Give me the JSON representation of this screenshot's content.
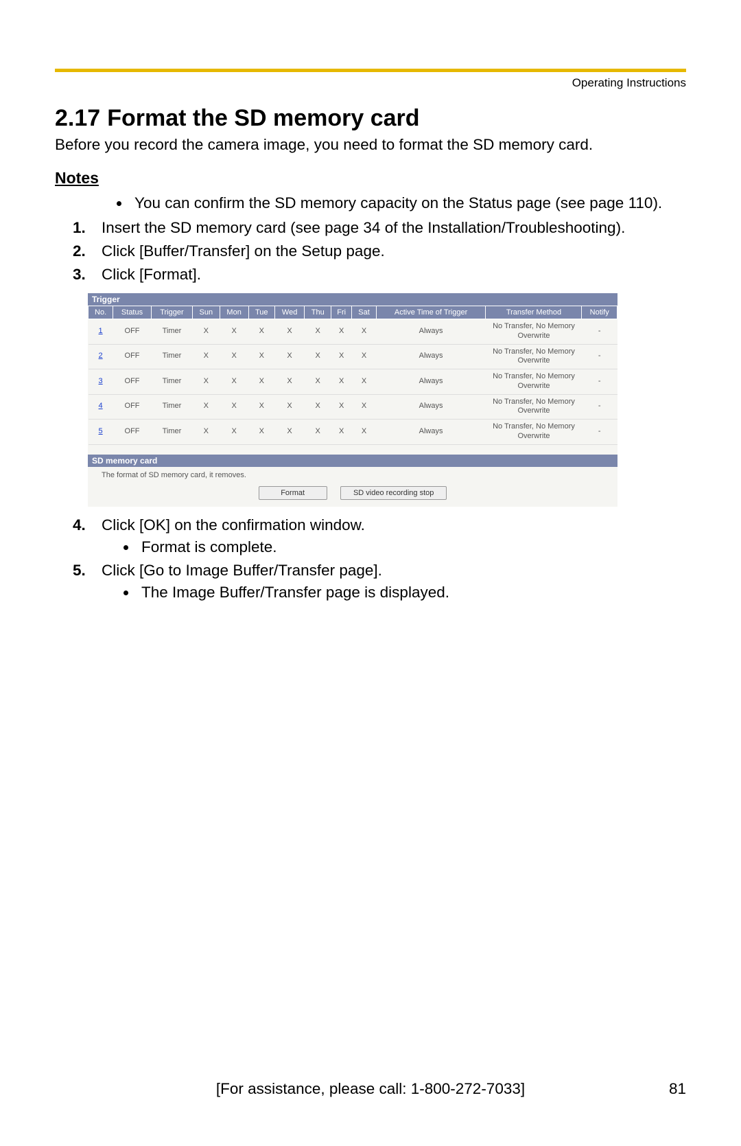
{
  "header": {
    "label": "Operating Instructions"
  },
  "section": {
    "number": "2.17",
    "title": "Format the SD memory card"
  },
  "intro": "Before you record the camera image, you need to format the SD memory card.",
  "notes": {
    "heading": "Notes",
    "items": [
      "You can confirm the SD memory capacity on the Status page (see page 110)."
    ]
  },
  "steps": [
    {
      "text": "Insert the SD memory card (see page 34 of the Installation/Troubleshooting)."
    },
    {
      "text": "Click [Buffer/Transfer] on the Setup page."
    },
    {
      "text": "Click [Format]."
    },
    {
      "text": "Click [OK] on the confirmation window.",
      "sub": [
        "Format is complete."
      ]
    },
    {
      "text": "Click [Go to Image Buffer/Transfer page].",
      "sub": [
        "The Image Buffer/Transfer page is displayed."
      ]
    }
  ],
  "trigger_panel": {
    "title": "Trigger",
    "columns": [
      "No.",
      "Status",
      "Trigger",
      "Sun",
      "Mon",
      "Tue",
      "Wed",
      "Thu",
      "Fri",
      "Sat",
      "Active Time of Trigger",
      "Transfer Method",
      "Notify"
    ],
    "rows": [
      {
        "no": "1",
        "status": "OFF",
        "trigger": "Timer",
        "days": [
          "X",
          "X",
          "X",
          "X",
          "X",
          "X",
          "X"
        ],
        "active": "Always",
        "method": "No Transfer, No Memory Overwrite",
        "notify": "-"
      },
      {
        "no": "2",
        "status": "OFF",
        "trigger": "Timer",
        "days": [
          "X",
          "X",
          "X",
          "X",
          "X",
          "X",
          "X"
        ],
        "active": "Always",
        "method": "No Transfer, No Memory Overwrite",
        "notify": "-"
      },
      {
        "no": "3",
        "status": "OFF",
        "trigger": "Timer",
        "days": [
          "X",
          "X",
          "X",
          "X",
          "X",
          "X",
          "X"
        ],
        "active": "Always",
        "method": "No Transfer, No Memory Overwrite",
        "notify": "-"
      },
      {
        "no": "4",
        "status": "OFF",
        "trigger": "Timer",
        "days": [
          "X",
          "X",
          "X",
          "X",
          "X",
          "X",
          "X"
        ],
        "active": "Always",
        "method": "No Transfer, No Memory Overwrite",
        "notify": "-"
      },
      {
        "no": "5",
        "status": "OFF",
        "trigger": "Timer",
        "days": [
          "X",
          "X",
          "X",
          "X",
          "X",
          "X",
          "X"
        ],
        "active": "Always",
        "method": "No Transfer, No Memory Overwrite",
        "notify": "-"
      }
    ]
  },
  "sd_panel": {
    "title": "SD memory card",
    "note": "The format of SD memory card, it removes.",
    "buttons": {
      "format": "Format",
      "stop": "SD video recording stop"
    }
  },
  "footer": {
    "assist": "[For assistance, please call: 1-800-272-7033]",
    "page": "81"
  }
}
